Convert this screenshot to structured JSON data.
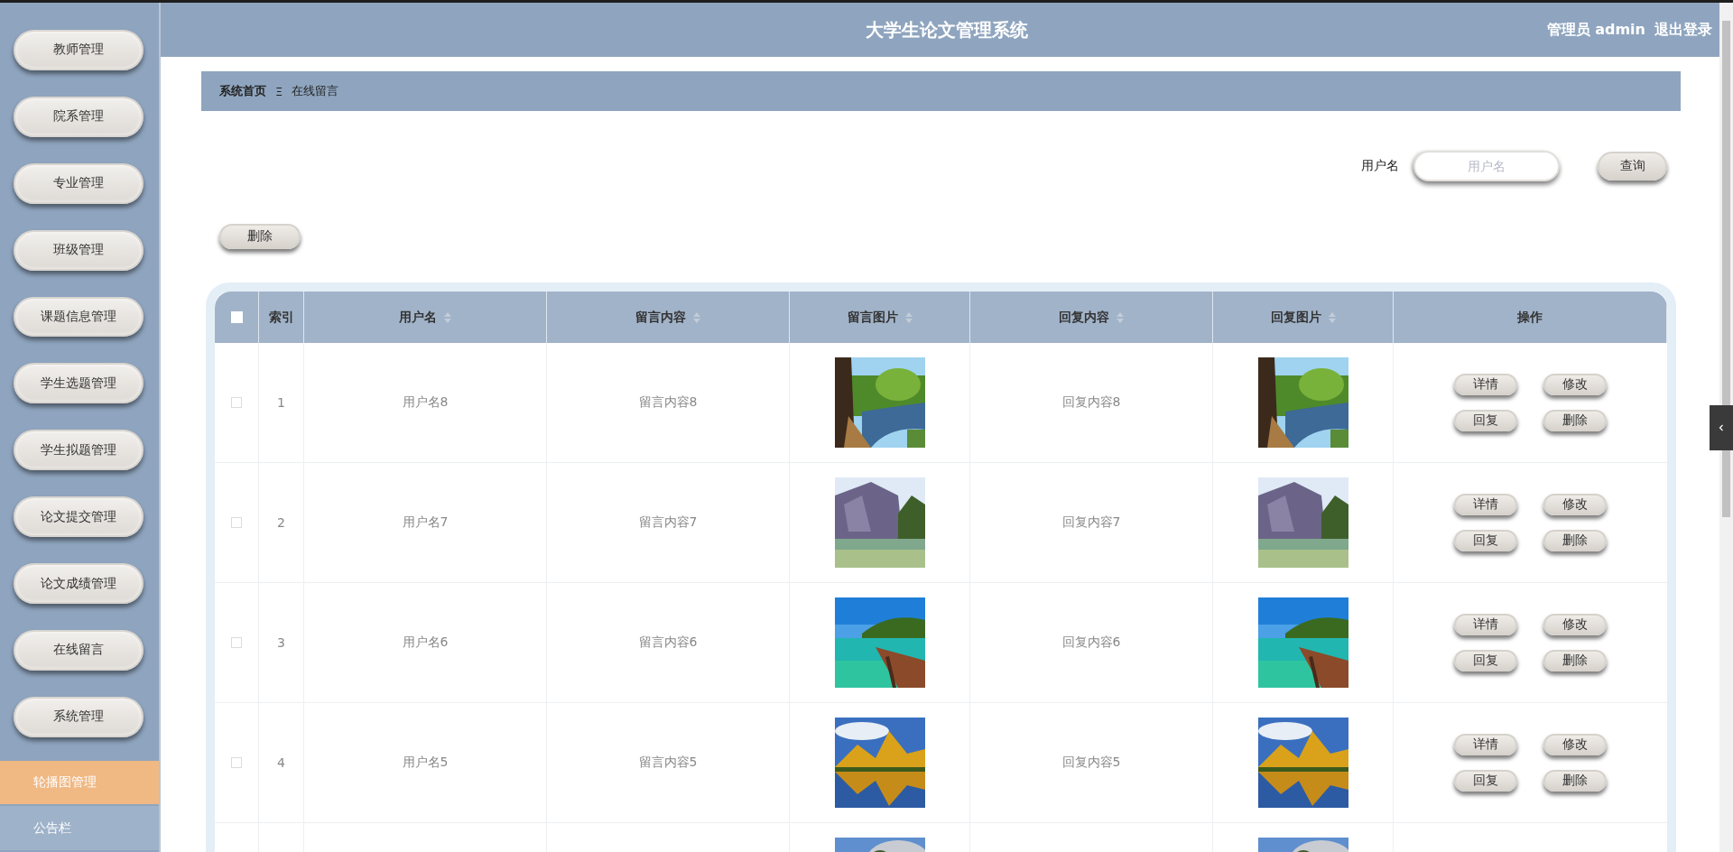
{
  "header": {
    "title": "大学生论文管理系统",
    "user": "管理员 admin",
    "logout": "退出登录"
  },
  "sidebar": {
    "items": [
      {
        "label": "教师管理",
        "kind": "pill",
        "selected": false
      },
      {
        "label": "院系管理",
        "kind": "pill",
        "selected": false
      },
      {
        "label": "专业管理",
        "kind": "pill",
        "selected": false
      },
      {
        "label": "班级管理",
        "kind": "pill",
        "selected": false
      },
      {
        "label": "课题信息管理",
        "kind": "pill",
        "selected": false
      },
      {
        "label": "学生选题管理",
        "kind": "pill",
        "selected": false
      },
      {
        "label": "学生拟题管理",
        "kind": "pill",
        "selected": false
      },
      {
        "label": "论文提交管理",
        "kind": "pill",
        "selected": false
      },
      {
        "label": "论文成绩管理",
        "kind": "pill",
        "selected": false
      },
      {
        "label": "在线留言",
        "kind": "pill",
        "selected": false
      },
      {
        "label": "系统管理",
        "kind": "pill",
        "selected": false
      },
      {
        "label": "轮播图管理",
        "kind": "flat",
        "selected": true
      },
      {
        "label": "公告栏",
        "kind": "flat",
        "selected": false
      }
    ]
  },
  "breadcrumb": {
    "home": "系统首页",
    "separator": "Ξ",
    "current": "在线留言"
  },
  "search": {
    "label": "用户名",
    "placeholder": "用户名",
    "button": "查询"
  },
  "toolbar": {
    "delete_button": "删除"
  },
  "table": {
    "select_all": false,
    "columns": [
      {
        "label": "索引",
        "sortable": false
      },
      {
        "label": "用户名",
        "sortable": true
      },
      {
        "label": "留言内容",
        "sortable": true
      },
      {
        "label": "留言图片",
        "sortable": true
      },
      {
        "label": "回复内容",
        "sortable": true
      },
      {
        "label": "回复图片",
        "sortable": true
      },
      {
        "label": "操作",
        "sortable": false
      }
    ],
    "rows": [
      {
        "kind": "full",
        "checked": false,
        "index": "1",
        "username": "用户名8",
        "content": "留言内容8",
        "reply": "回复内容8",
        "actions": [
          "详情",
          "修改",
          "回复",
          "删除"
        ]
      },
      {
        "kind": "full",
        "checked": false,
        "index": "2",
        "username": "用户名7",
        "content": "留言内容7",
        "reply": "回复内容7",
        "actions": [
          "详情",
          "修改",
          "回复",
          "删除"
        ]
      },
      {
        "kind": "full",
        "checked": false,
        "index": "3",
        "username": "用户名6",
        "content": "留言内容6",
        "reply": "回复内容6",
        "actions": [
          "详情",
          "修改",
          "回复",
          "删除"
        ]
      },
      {
        "kind": "full",
        "checked": false,
        "index": "4",
        "username": "用户名5",
        "content": "留言内容5",
        "reply": "回复内容5",
        "actions": [
          "详情",
          "修改",
          "回复",
          "删除"
        ]
      },
      {
        "kind": "partial"
      }
    ]
  }
}
